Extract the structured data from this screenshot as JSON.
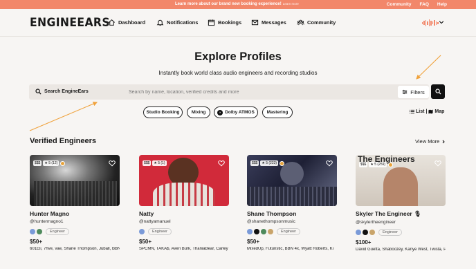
{
  "banner": {
    "message": "Learn more about our brand new booking experience!",
    "link": "Learn more",
    "links": [
      "Community",
      "FAQ",
      "Help"
    ]
  },
  "nav": {
    "logo": "ENGINEEARS",
    "items": [
      {
        "label": "Dashboard",
        "icon": "home-icon"
      },
      {
        "label": "Notifications",
        "icon": "bell-icon"
      },
      {
        "label": "Bookings",
        "icon": "calendar-icon"
      },
      {
        "label": "Messages",
        "icon": "mail-icon"
      },
      {
        "label": "Community",
        "icon": "people-icon"
      }
    ]
  },
  "header": {
    "title": "Explore Profiles",
    "subtitle": "Instantly book world class audio engineers and recording studios"
  },
  "search": {
    "label": "Search EngineEars",
    "placeholder": "Search by name, location, verified credits and more",
    "filters_label": "Filters"
  },
  "chips": [
    "Studio Booking",
    "Mixing",
    "Dolby ATMOS",
    "Mastering"
  ],
  "view_toggle": {
    "list": "List",
    "map": "Map"
  },
  "section": {
    "title": "Verified Engineers",
    "view_more": "View More"
  },
  "colors": {
    "accent": "#f2876a",
    "background": "#f7f5f3"
  },
  "engineers": [
    {
      "name": "Hunter Magno",
      "handle": "@huntermagno1",
      "price_tier": "$$$",
      "rating": "★ 5 (12)",
      "role": "Engineer",
      "price": "$50+",
      "credits": "601Eli, 7hve, vae, Shane Thompson, Juball, BBN"
    },
    {
      "name": "Natty",
      "handle": "@nattyamanuel",
      "price_tier": "$$$",
      "rating": "★ 5 (1)",
      "role": "Engineer",
      "price": "$50+",
      "credits": "SPCMN, TAKA$, Averi Burk, ThaniaBear, Carley"
    },
    {
      "name": "Shane Thompson",
      "handle": "@shanethompsonmusic",
      "price_tier": "$$$",
      "rating": "★ 5 (223)",
      "role": "Engineer",
      "price": "$50+",
      "credits": "MixedUp, Futuristic, BBN 4x, Wyatt Roberts, Ki"
    },
    {
      "name": "Skyler The Engineer",
      "handle": "@skylertheengineer",
      "price_tier": "$$$",
      "rating": "★ 5 (259)",
      "role": "Engineer",
      "price": "$100+",
      "credits": "David Guetta, Shaboozey, Kanye West, Twista, P",
      "image_text": "The Engineers"
    }
  ]
}
